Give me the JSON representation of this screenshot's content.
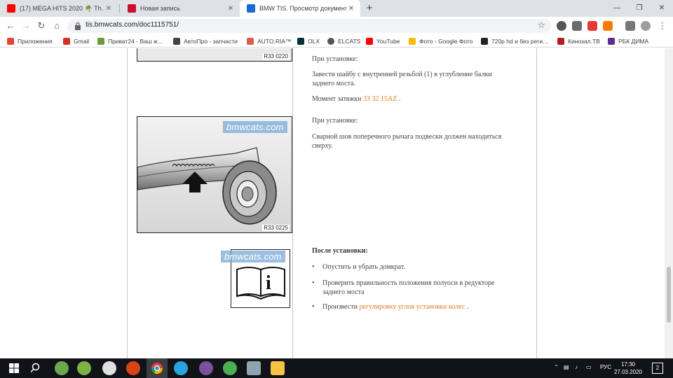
{
  "browser": {
    "tabs": [
      {
        "title": "(17) MEGA HITS 2020 🌴 Th…",
        "color": "#ff0000",
        "active": false
      },
      {
        "title": "Новая запись",
        "color": "#c8102e",
        "active": false
      },
      {
        "title": "BMW TIS. Просмотр документа",
        "color": "#1c69d4",
        "active": true
      }
    ],
    "new_tab_label": "+",
    "url": "tis.bmwcats.com/doc1115751/",
    "bookmarks": [
      {
        "label": "Приложения",
        "color": "#ea4335"
      },
      {
        "label": "Gmail",
        "color": "#d93025"
      },
      {
        "label": "Приват24 - Ваш ж…",
        "color": "#6a9a3a"
      },
      {
        "label": "АвтоПро - запчасти",
        "color": "#444444"
      },
      {
        "label": "AUTO.RIA™",
        "color": "#db5c4c"
      },
      {
        "label": "OLX",
        "color": "#002f34"
      },
      {
        "label": "ELCATS",
        "color": "#555555"
      },
      {
        "label": "YouTube",
        "color": "#ff0000"
      },
      {
        "label": "Фото - Google Фото",
        "color": "#fbbc04"
      },
      {
        "label": "720p hd и без реги…",
        "color": "#222222"
      },
      {
        "label": "Кинозал.ТВ",
        "color": "#b71c1c"
      },
      {
        "label": "РБК ДИМА",
        "color": "#5b2d8e"
      }
    ]
  },
  "document": {
    "fig1_code": "R33 0220",
    "section1": {
      "heading": "При установке:",
      "para": "Завести шайбу с внутренней резьбой (1) в углубление балки заднего моста.",
      "torque_label": "Момент затяжки",
      "torque_link": "33 32 15AZ",
      "torque_suffix": "."
    },
    "fig2_code": "R33 0225",
    "section2": {
      "heading": "При установке:",
      "para": "Сварной шов поперечного рычага подвески должен находиться сверху."
    },
    "watermark": "bmwcats.com",
    "info_icon_letter": "i",
    "section3": {
      "heading": "После установки:",
      "bullet1": "Опустить и убрать домкрат.",
      "bullet2": "Проверить правильность положения полуоси в редукторе заднего моста",
      "bullet3_prefix": "Произвести",
      "bullet3_link": "регулировку углов установки колес",
      "bullet3_suffix": "."
    }
  },
  "taskbar": {
    "language": "РУС",
    "time": "17:30",
    "date": "27.03.2020",
    "notifications": "2"
  }
}
